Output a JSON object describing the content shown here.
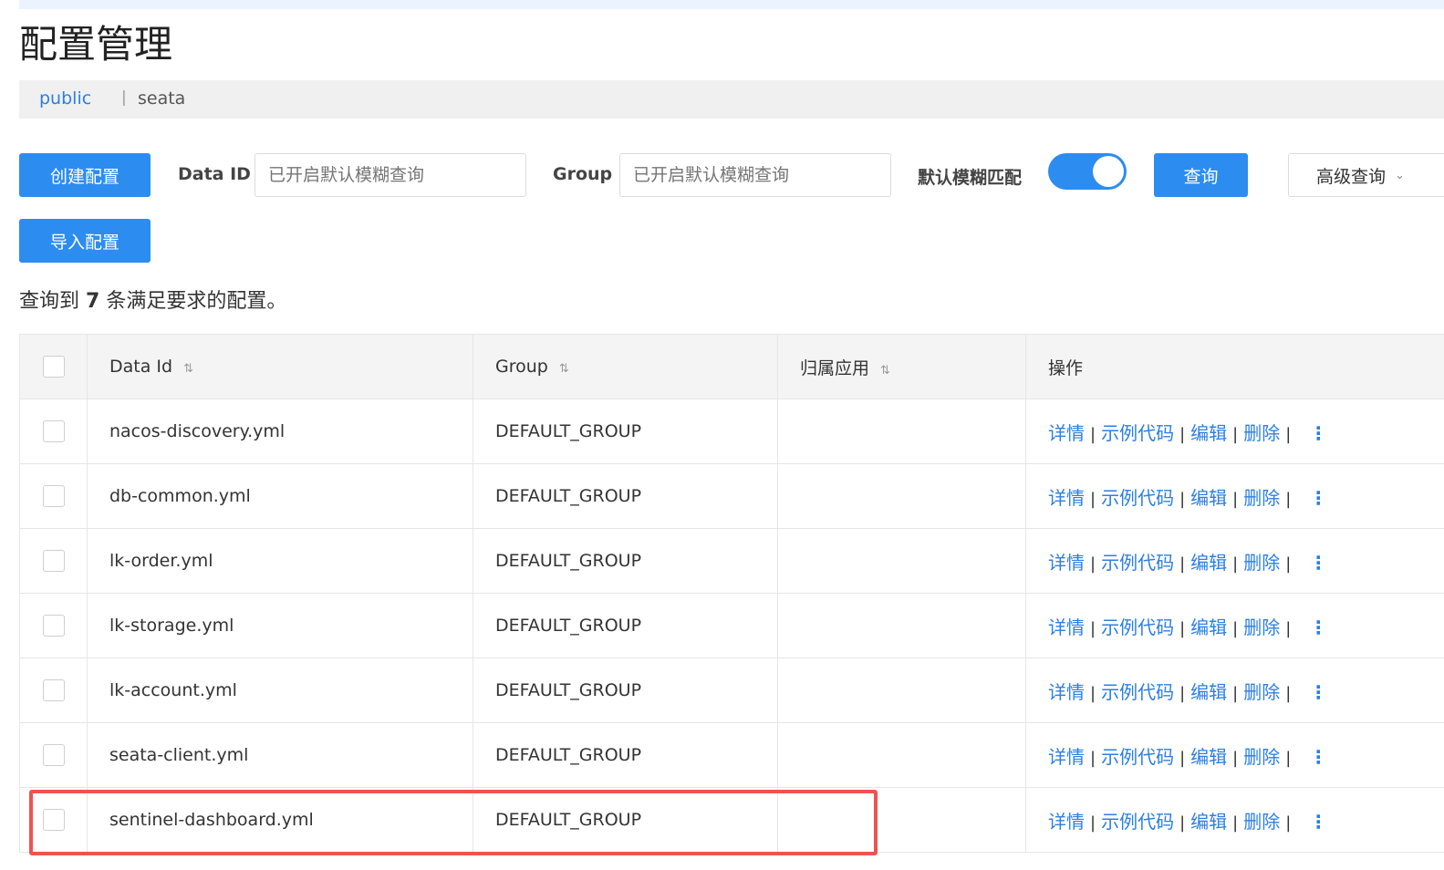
{
  "page": {
    "title": "配置管理"
  },
  "namespaces": {
    "active": "public",
    "separator": "|",
    "other": "seata"
  },
  "toolbar": {
    "create_label": "创建配置",
    "import_label": "导入配置",
    "data_id_label": "Data ID",
    "data_id_placeholder": "已开启默认模糊查询",
    "group_label": "Group",
    "group_placeholder": "已开启默认模糊查询",
    "fuzzy_label": "默认模糊匹配",
    "fuzzy_enabled": true,
    "search_label": "查询",
    "advanced_label": "高级查询",
    "advanced_icon": "chevron-down-icon"
  },
  "result": {
    "prefix": "查询到",
    "count": "7",
    "suffix": "条满足要求的配置。"
  },
  "table": {
    "columns": {
      "data_id": "Data Id",
      "group": "Group",
      "app": "归属应用",
      "ops": "操作"
    },
    "sort_glyph": "⇅",
    "actions": {
      "detail": "详情",
      "sample": "示例代码",
      "edit": "编辑",
      "delete": "删除",
      "sep": "|",
      "more": "⋮"
    },
    "rows": [
      {
        "data_id": "nacos-discovery.yml",
        "group": "DEFAULT_GROUP",
        "app": ""
      },
      {
        "data_id": "db-common.yml",
        "group": "DEFAULT_GROUP",
        "app": ""
      },
      {
        "data_id": "lk-order.yml",
        "group": "DEFAULT_GROUP",
        "app": ""
      },
      {
        "data_id": "lk-storage.yml",
        "group": "DEFAULT_GROUP",
        "app": ""
      },
      {
        "data_id": "lk-account.yml",
        "group": "DEFAULT_GROUP",
        "app": ""
      },
      {
        "data_id": "seata-client.yml",
        "group": "DEFAULT_GROUP",
        "app": ""
      },
      {
        "data_id": "sentinel-dashboard.yml",
        "group": "DEFAULT_GROUP",
        "app": ""
      }
    ]
  },
  "colors": {
    "primary": "#2d8cf0",
    "link": "#2b7fe4",
    "highlight": "#ef5350"
  }
}
